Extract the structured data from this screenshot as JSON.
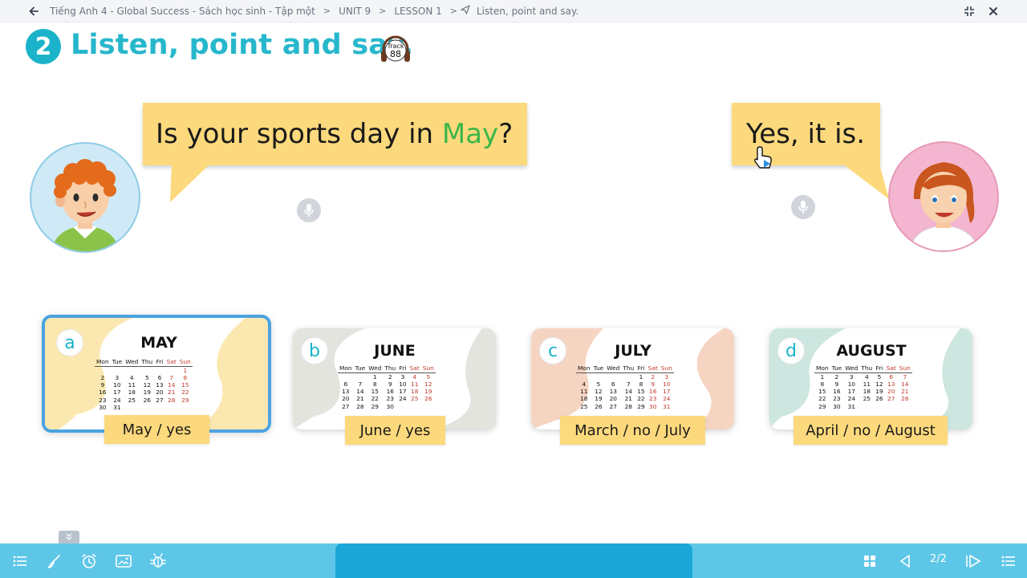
{
  "breadcrumb": {
    "items": [
      "Tiếng Anh 4 - Global Success - Sách học sinh - Tập một",
      "UNIT 9",
      "LESSON 1",
      "Listen, point and say."
    ]
  },
  "window": {
    "exit_fullscreen_icon": "compress-icon",
    "close_icon": "close-icon"
  },
  "exercise": {
    "number": "2",
    "title": "Listen, point and say.",
    "track": {
      "label": "Track",
      "number": "88"
    }
  },
  "dialogue": {
    "question_prefix": "Is your sports day in ",
    "question_highlight": "May",
    "question_suffix": "?",
    "answer": "Yes, it is."
  },
  "weekdays": [
    "Mon",
    "Tue",
    "Wed",
    "Thu",
    "Fri",
    "Sat",
    "Sun"
  ],
  "cards": [
    {
      "letter": "a",
      "month": "MAY",
      "option": "May / yes",
      "selected": true,
      "color": "#fbe8b0",
      "rows": [
        [
          "",
          "",
          "",
          "",
          "",
          "",
          "1"
        ],
        [
          "2",
          "3",
          "4",
          "5",
          "6",
          "7",
          "8"
        ],
        [
          "9",
          "10",
          "11",
          "12",
          "13",
          "14",
          "15"
        ],
        [
          "16",
          "17",
          "18",
          "19",
          "20",
          "21",
          "22"
        ],
        [
          "23",
          "24",
          "25",
          "26",
          "27",
          "28",
          "29"
        ],
        [
          "30",
          "31",
          "",
          "",
          "",
          "",
          ""
        ]
      ]
    },
    {
      "letter": "b",
      "month": "JUNE",
      "option": "June / yes",
      "selected": false,
      "color": "#e3e4de",
      "rows": [
        [
          "",
          "",
          "1",
          "2",
          "3",
          "4",
          "5"
        ],
        [
          "6",
          "7",
          "8",
          "9",
          "10",
          "11",
          "12"
        ],
        [
          "13",
          "14",
          "15",
          "16",
          "17",
          "18",
          "19"
        ],
        [
          "20",
          "21",
          "22",
          "23",
          "24",
          "25",
          "26"
        ],
        [
          "27",
          "28",
          "29",
          "30",
          "",
          "",
          ""
        ]
      ]
    },
    {
      "letter": "c",
      "month": "JULY",
      "option": "March / no / July",
      "selected": false,
      "color": "#f6d4c2",
      "rows": [
        [
          "",
          "",
          "",
          "",
          "1",
          "2",
          "3"
        ],
        [
          "4",
          "5",
          "6",
          "7",
          "8",
          "9",
          "10"
        ],
        [
          "11",
          "12",
          "13",
          "14",
          "15",
          "16",
          "17"
        ],
        [
          "18",
          "19",
          "20",
          "21",
          "22",
          "23",
          "24"
        ],
        [
          "25",
          "26",
          "27",
          "28",
          "29",
          "30",
          "31"
        ]
      ]
    },
    {
      "letter": "d",
      "month": "AUGUST",
      "option": "April / no / August",
      "selected": false,
      "color": "#cde6df",
      "rows": [
        [
          "1",
          "2",
          "3",
          "4",
          "5",
          "6",
          "7"
        ],
        [
          "8",
          "9",
          "10",
          "11",
          "12",
          "13",
          "14"
        ],
        [
          "15",
          "16",
          "17",
          "18",
          "19",
          "20",
          "21"
        ],
        [
          "22",
          "23",
          "24",
          "25",
          "26",
          "27",
          "28"
        ],
        [
          "29",
          "30",
          "31",
          "",
          "",
          "",
          ""
        ]
      ]
    }
  ],
  "toolbar": {
    "page_indicator": "2/2",
    "left_icons": [
      "menu-icon",
      "brush-icon",
      "alarm-clock-icon",
      "image-icon",
      "bug-icon"
    ],
    "right_icons": [
      "grid-icon",
      "prev-icon",
      "next-icon",
      "menu-icon"
    ]
  },
  "colors": {
    "accent": "#27b7cc",
    "bubble": "#fcd97c",
    "highlight": "#3cb64a",
    "toolbar": "#5ec7e8",
    "toolbar_center": "#1aa7d8",
    "selected_border": "#4aa3e0"
  }
}
